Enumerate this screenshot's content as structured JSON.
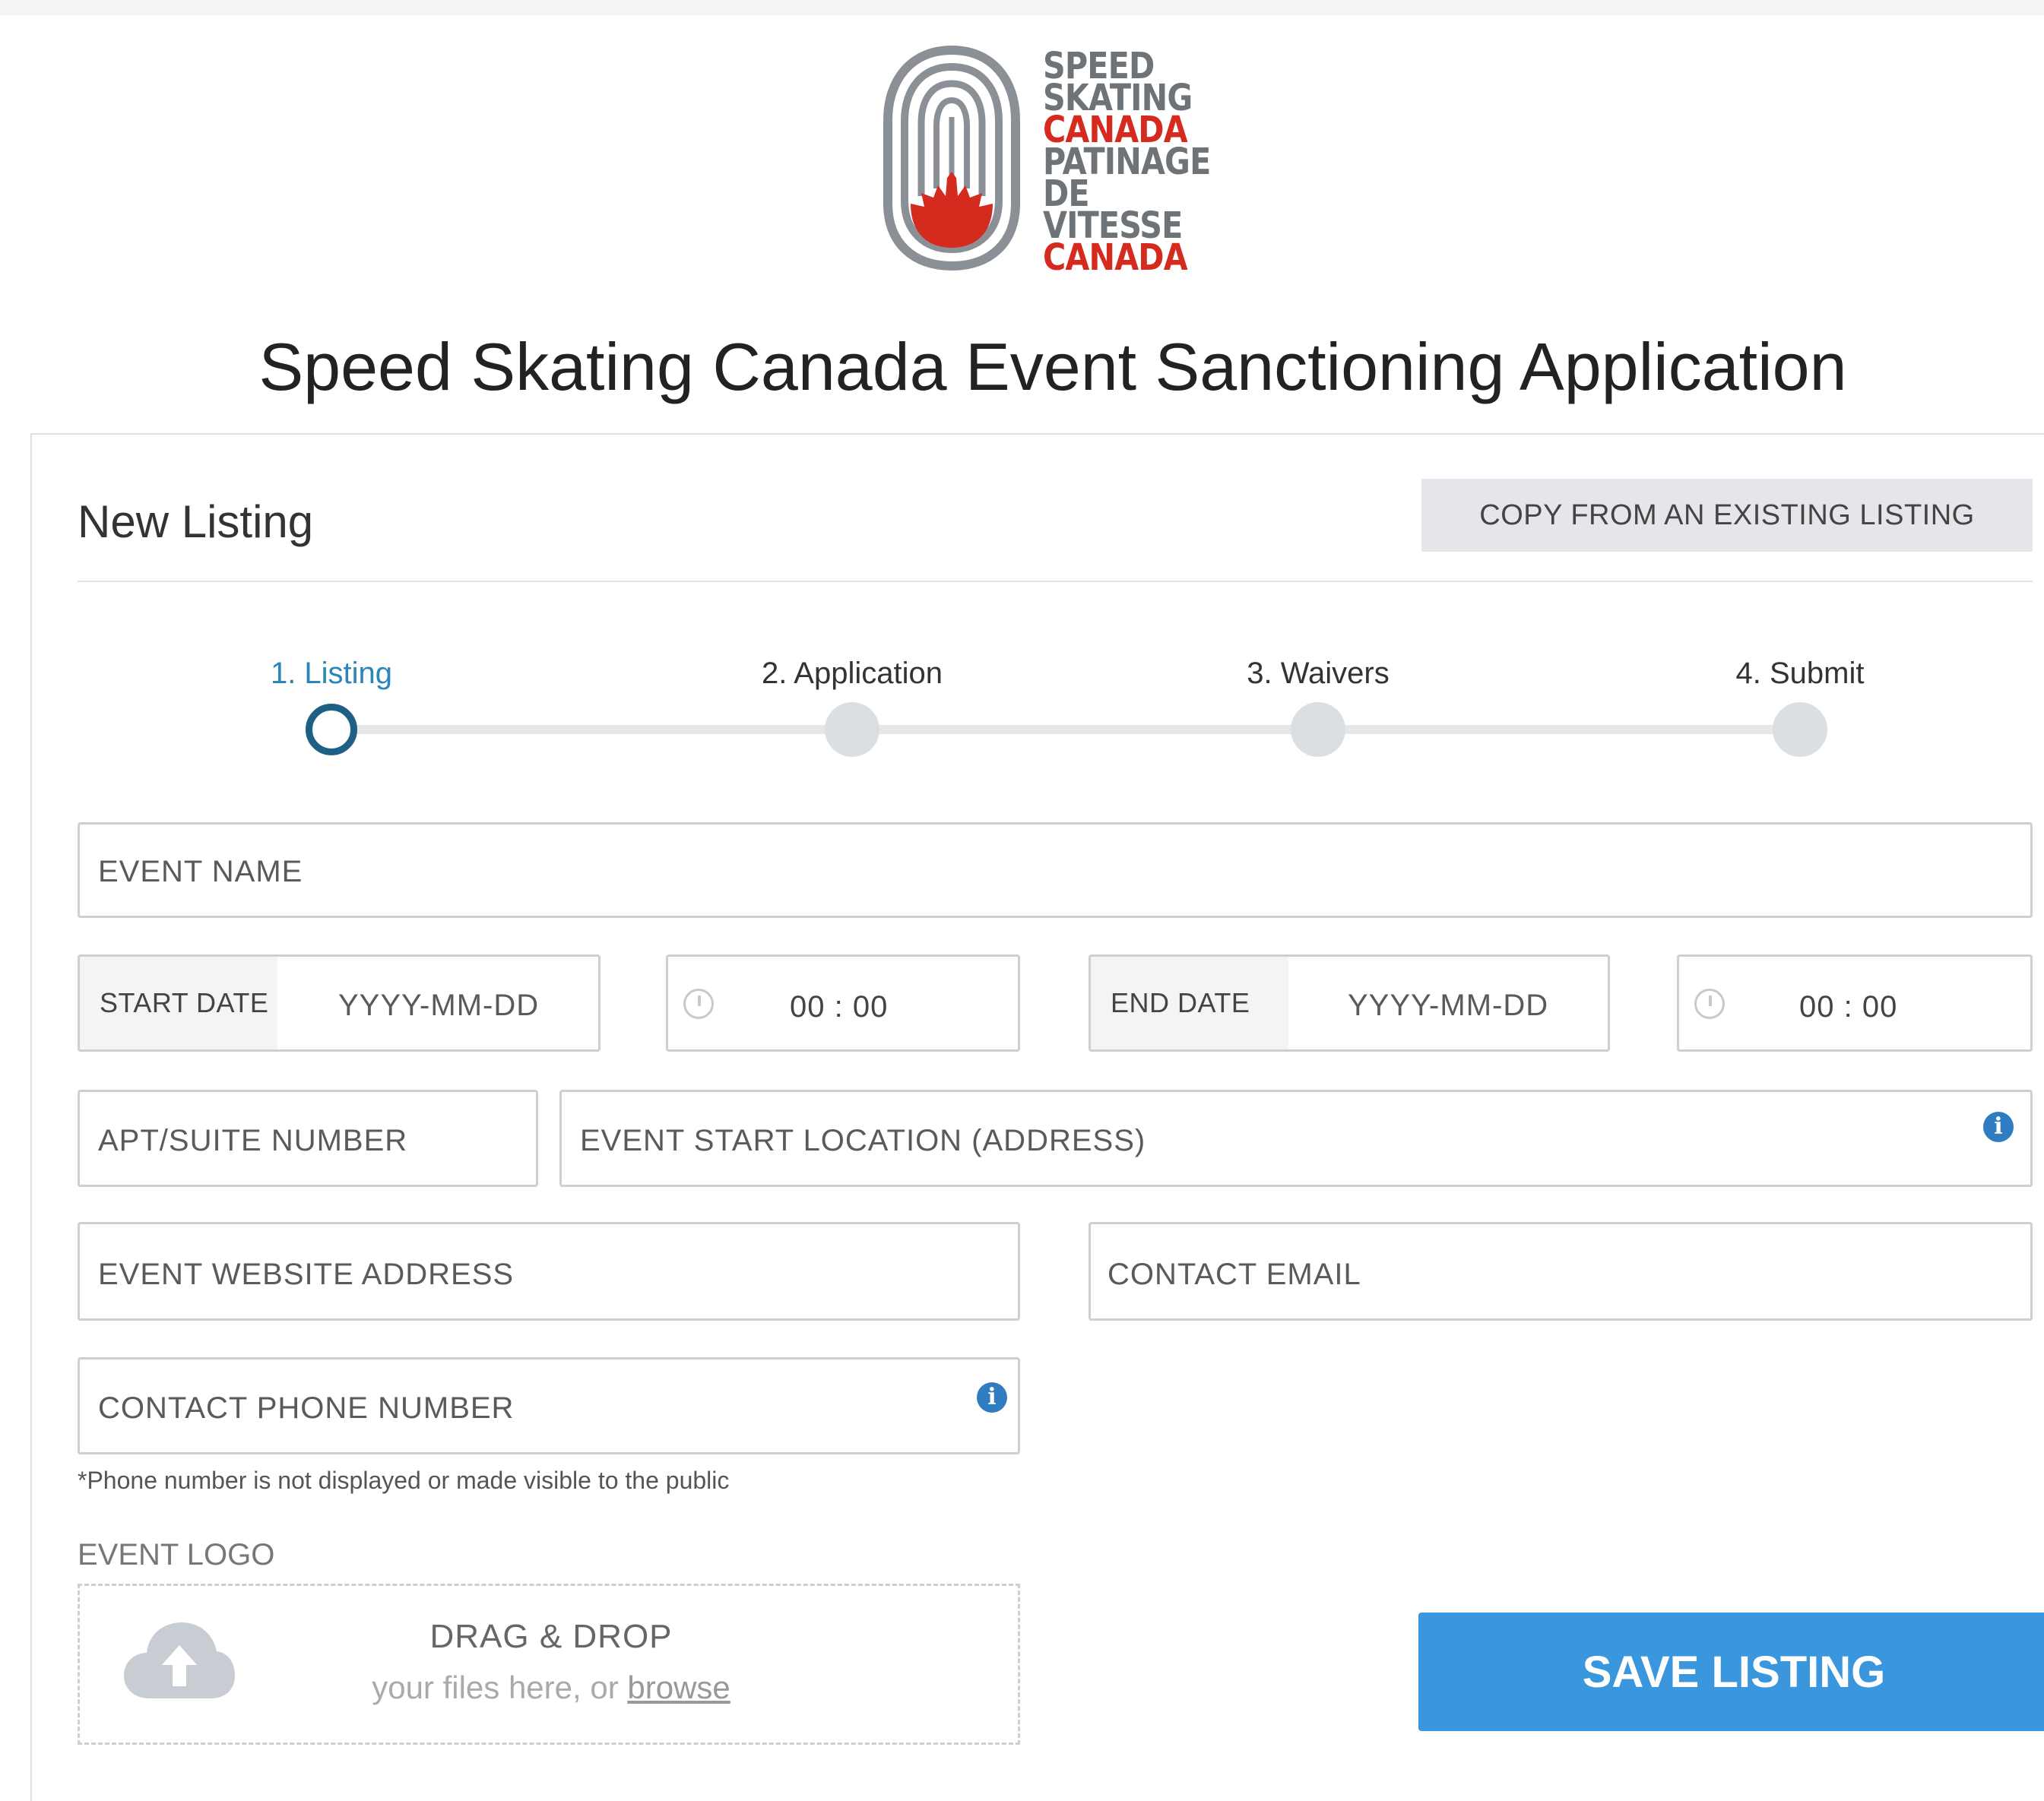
{
  "brand": {
    "logo_lines": [
      "SPEED",
      "SKATING",
      "CANADA",
      "PATINAGE",
      "DE VITESSE",
      "CANADA"
    ]
  },
  "page_title": "Speed Skating Canada Event Sanctioning Application",
  "card": {
    "title": "New Listing",
    "copy_button": "COPY FROM AN EXISTING LISTING"
  },
  "steps": [
    {
      "label": "1. Listing",
      "active": true
    },
    {
      "label": "2. Application",
      "active": false
    },
    {
      "label": "3. Waivers",
      "active": false
    },
    {
      "label": "4. Submit",
      "active": false
    }
  ],
  "form": {
    "event_name": "EVENT NAME",
    "start_date_label": "START DATE",
    "start_date_placeholder": "YYYY-MM-DD",
    "start_time": "00 : 00",
    "end_date_label": "END DATE",
    "end_date_placeholder": "YYYY-MM-DD",
    "end_time": "00 : 00",
    "apt_suite": "APT/SUITE NUMBER",
    "start_location": "EVENT START LOCATION (ADDRESS)",
    "website": "EVENT WEBSITE ADDRESS",
    "contact_email": "CONTACT EMAIL",
    "contact_phone": "CONTACT PHONE NUMBER",
    "phone_note": "*Phone number is not displayed or made visible to the public",
    "logo_label": "EVENT LOGO",
    "dropzone_title": "DRAG & DROP",
    "dropzone_sub": "your files here, or",
    "dropzone_browse": "browse"
  },
  "save_button": "SAVE LISTING",
  "colors": {
    "accent_blue": "#3a97dd",
    "step_active": "#2a86b8",
    "brand_red": "#d52b1e",
    "brand_gray": "#6e7378"
  },
  "icons": [
    "clock-icon",
    "info-icon",
    "cloud-upload-icon"
  ]
}
